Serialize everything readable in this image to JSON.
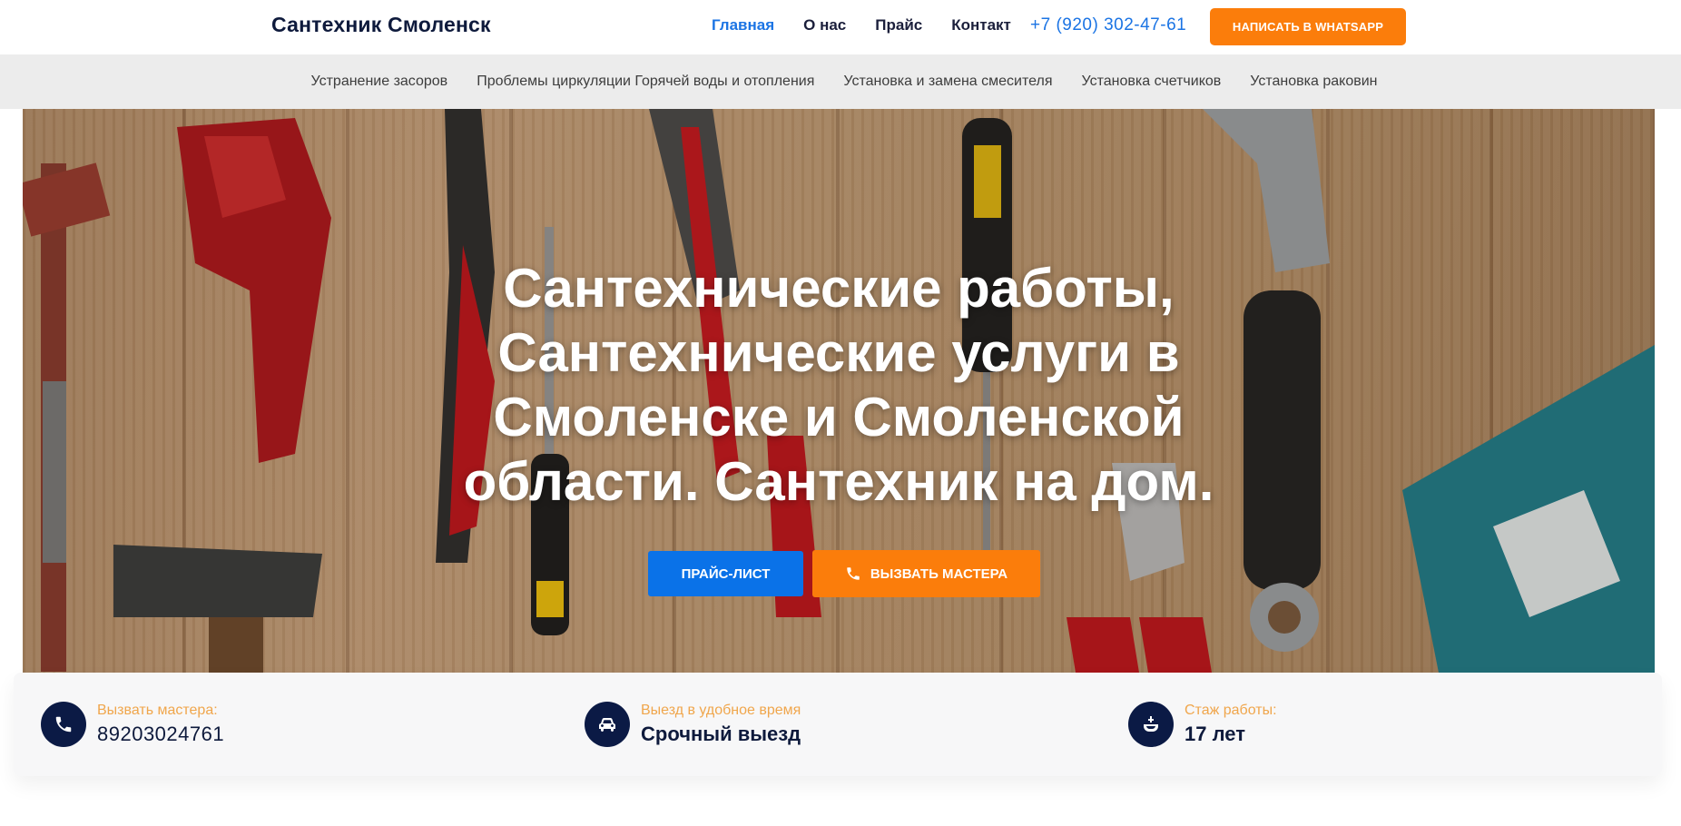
{
  "header": {
    "brand": "Сантехник Смоленск",
    "nav": [
      "Главная",
      "О нас",
      "Прайс",
      "Контакт"
    ],
    "phone": "+7 (920) 302-47-61",
    "whatsapp_button": "НАПИСАТЬ В WHATSAPP"
  },
  "subnav": [
    "Устранение засоров",
    "Проблемы циркуляции Горячей воды и отопления",
    "Установка и замена смесителя",
    "Установка счетчиков",
    "Установка раковин"
  ],
  "hero": {
    "title_lines": [
      "Сантехнические работы,",
      "Сантехнические услуги в",
      "Смоленске и Смоленской",
      "области. Сантехник на дом."
    ],
    "price_button": "ПРАЙС-ЛИСТ",
    "call_button": "ВЫЗВАТЬ МАСТЕРА"
  },
  "info": [
    {
      "icon": "phone-icon",
      "label": "Вызвать мастера:",
      "value": "89203024761"
    },
    {
      "icon": "car-icon",
      "label": "Выезд в удобное время",
      "value": "Срочный выезд"
    },
    {
      "icon": "faucet-icon",
      "label": "Стаж работы:",
      "value": "17 лет"
    }
  ],
  "colors": {
    "accent": "#1b74e4",
    "orange": "#fb7d0b",
    "navy": "#0b1a45",
    "label_orange": "#f0a64c"
  }
}
